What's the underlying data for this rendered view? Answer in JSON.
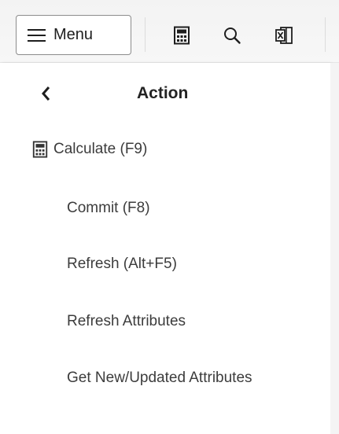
{
  "toolbar": {
    "menu_label": "Menu",
    "icons": [
      "calculator-icon",
      "search-icon",
      "excel-icon"
    ]
  },
  "panel": {
    "title": "Action",
    "items": [
      {
        "label": "Calculate (F9)",
        "icon": "calculator-icon"
      },
      {
        "label": "Commit (F8)"
      },
      {
        "label": "Refresh (Alt+F5)"
      },
      {
        "label": "Refresh Attributes"
      },
      {
        "label": "Get New/Updated Attributes"
      }
    ]
  },
  "colors": {
    "toolbar_bg": "#f3f3f3",
    "text": "#3c3c3c",
    "title": "#222222"
  }
}
